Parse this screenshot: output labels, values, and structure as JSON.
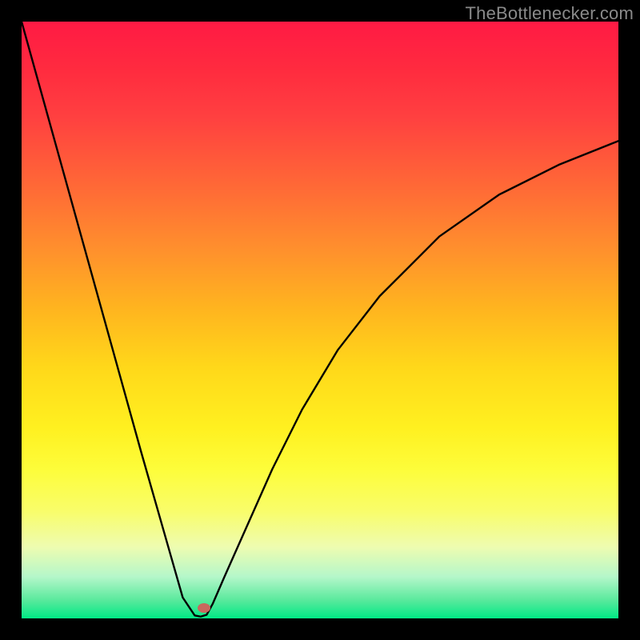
{
  "watermark": "TheBottlenecker.com",
  "chart_data": {
    "type": "line",
    "title": "",
    "xlabel": "",
    "ylabel": "",
    "xlim": [
      0,
      100
    ],
    "ylim": [
      0,
      100
    ],
    "grid": false,
    "series": [
      {
        "name": "bottleneck-curve",
        "x": [
          0,
          5,
          10,
          15,
          20,
          25,
          27,
          29,
          30,
          31,
          32,
          34,
          38,
          42,
          47,
          53,
          60,
          70,
          80,
          90,
          100
        ],
        "values": [
          100,
          82,
          64,
          46,
          28,
          10.5,
          3.5,
          0.5,
          0.3,
          0.6,
          2.4,
          7.0,
          16,
          25,
          35,
          45,
          54,
          64,
          71,
          76,
          80
        ]
      }
    ],
    "marker": {
      "x": 30.5,
      "y": 1.7,
      "color": "#c8685e"
    },
    "frame": {
      "border_px": 27,
      "border_color": "#000000"
    },
    "gradient_stops": [
      {
        "pos": 0,
        "color": "#ff1a44"
      },
      {
        "pos": 50,
        "color": "#ffd81a"
      },
      {
        "pos": 100,
        "color": "#00e985"
      }
    ]
  }
}
